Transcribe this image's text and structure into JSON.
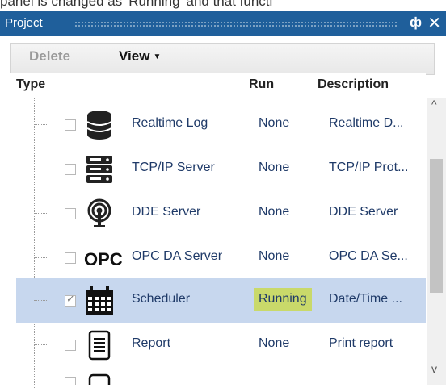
{
  "caption": "panel is changed as 'Running' and that functi",
  "panel": {
    "title": "Project",
    "pin_glyph": "ф",
    "close_glyph": "✕"
  },
  "toolbar": {
    "delete_label": "Delete",
    "view_label": "View",
    "view_chevron": "▼"
  },
  "columns": {
    "type": "Type",
    "run": "Run",
    "description": "Description"
  },
  "rows": [
    {
      "name": "Realtime Log",
      "run": "None",
      "description": "Realtime D...",
      "icon": "database-icon",
      "checked": false
    },
    {
      "name": "TCP/IP Server",
      "run": "None",
      "description": "TCP/IP Prot...",
      "icon": "server-rack-icon",
      "checked": false
    },
    {
      "name": "DDE Server",
      "run": "None",
      "description": "DDE Server",
      "icon": "antenna-icon",
      "checked": false
    },
    {
      "name": "OPC DA Server",
      "run": "None",
      "description": "OPC DA Se...",
      "icon": "opc-icon",
      "icon_text": "OPC",
      "checked": false
    },
    {
      "name": "Scheduler",
      "run": "Running",
      "description": "Date/Time ...",
      "icon": "calendar-icon",
      "checked": true,
      "selected": true
    },
    {
      "name": "Report",
      "run": "None",
      "description": "Print report",
      "icon": "document-icon",
      "checked": false
    }
  ],
  "scroll": {
    "up_glyph": "^",
    "down_glyph": "v"
  },
  "colors": {
    "title_bar": "#1f5f9b",
    "selected_row": "#c7d7ee",
    "running_badge": "#c9d96a"
  }
}
